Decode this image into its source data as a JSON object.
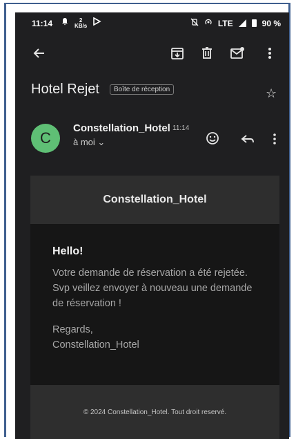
{
  "status_bar": {
    "time": "11:14",
    "kb_top": "2",
    "kb_bottom": "KB/s",
    "network": "LTE",
    "battery": "90 %"
  },
  "toolbar": {
    "back_icon": "arrow-left-icon",
    "archive_icon": "archive-icon",
    "delete_icon": "trash-icon",
    "mark_unread_icon": "mail-unread-icon",
    "more_icon": "more-vertical-icon"
  },
  "email": {
    "subject": "Hotel Rejet",
    "label": "Boîte de réception",
    "sender_name": "Constellation_Hotel",
    "sender_initial": "C",
    "time": "11:14",
    "recipient": "à moi ⌄",
    "header_title": "Constellation_Hotel",
    "greeting": "Hello!",
    "message": "Votre demande de réservation a été rejetée. Svp veillez envoyer à nouveau une demande de réservation !",
    "regards_line1": "Regards,",
    "regards_line2": "Constellation_Hotel",
    "footer": "© 2024 Constellation_Hotel. Tout droit reservé."
  },
  "colors": {
    "background": "#1f1f21",
    "avatar": "#5fbf75",
    "frame": "#3f5f8f"
  }
}
